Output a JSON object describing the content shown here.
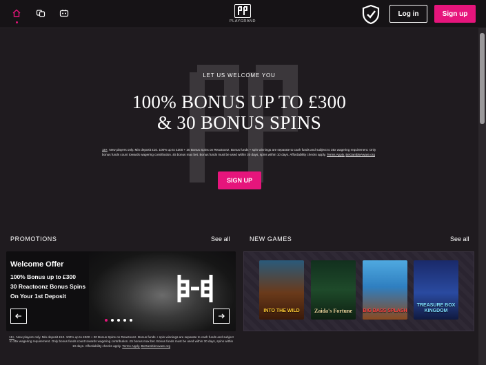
{
  "header": {
    "nav_icons": [
      "home-icon",
      "casino-chips-icon",
      "live-casino-icon"
    ],
    "logo_text": "PLAYGRAND",
    "login_label": "Log in",
    "signup_label": "Sign up"
  },
  "hero": {
    "eyebrow": "LET US WELCOME YOU",
    "title_line1": "100% BONUS UP TO £300",
    "title_line2": "& 30 BONUS SPINS",
    "terms_age": "18+",
    "terms_text": ". New players only. Min deposit £10. 100% up to £300 + 30 Bonus Spins on Reactoonz. Bonus funds + spin winnings are separate to cash funds and subject to 35x wagering requirement. Only bonus funds count towards wagering contribution. £5 bonus max bet. Bonus funds must be used within 30 days, spins within 10 days. Affordability checks apply. ",
    "terms_link": "Terms Apply.",
    "terms_link2": "BeGambleAware.org",
    "cta_label": "SIGN UP"
  },
  "promotions": {
    "section_label": "PROMOTIONS",
    "see_all": "See all",
    "card_title": "Welcome Offer",
    "card_lines": [
      "100% Bonus up to £300",
      "30 Reactoonz Bonus Spins",
      "On Your 1st Deposit"
    ],
    "slide_count": 5,
    "active_slide": 1,
    "terms_age": "18+",
    "terms_text": ". New players only. Min deposit £10. 100% up to £300 + 30 Bonus Spins on Reactoonz. Bonus funds + spin winnings are separate to cash funds and subject to 35x wagering requirement. Only bonus funds count towards wagering contribution. £5 bonus max bet. Bonus funds must be used within 30 days, spins within 10 days. Affordability checks apply. ",
    "terms_link": "Terms Apply.",
    "terms_link2": "BeGambleAware.org"
  },
  "new_games": {
    "section_label": "NEW GAMES",
    "see_all": "See all",
    "games": [
      {
        "name": "INTO THE WILD"
      },
      {
        "name": "Zaida's Fortune"
      },
      {
        "name": "BIG BASS SPLASH"
      },
      {
        "name": "TREASURE BOX KINGDOM"
      }
    ]
  },
  "colors": {
    "accent": "#e6157c",
    "background": "#1f1b1f",
    "header": "#161316"
  }
}
